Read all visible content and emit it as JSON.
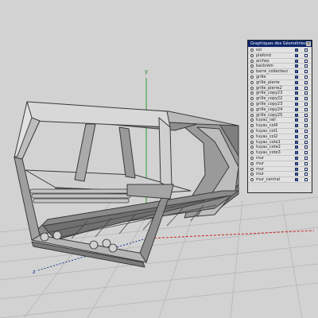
{
  "panel": {
    "title": "Graphiques des Géométries",
    "layers": [
      "sol",
      "plafond",
      "arches",
      "backrèm",
      "barre_collecteur",
      "grille",
      "grille_pierre",
      "grille_pierre2",
      "grille_copy23",
      "grille_copy22",
      "grille_copy23",
      "grille_copy24",
      "grille_copy25",
      "tuyau_rail",
      "tuyau_col4",
      "tuyau_col1",
      "tuyau_col2",
      "tuyau_cote1",
      "tuyau_cote2",
      "tuyau_cote3",
      "mur",
      "mur",
      "mur",
      "mur",
      "mur_central"
    ]
  },
  "viewport": {
    "axis_y_label": "y",
    "axis_z_label": "z"
  },
  "colors": {
    "background": "#d2d2d2",
    "grid": "#b8b8b8",
    "axis_x": "#cc2222",
    "axis_y": "#2e9d32",
    "axis_z": "#1a3a8a",
    "title_bar": "#0a246a",
    "model_light": "#a9a9a9",
    "model_dark": "#5a5a5a"
  }
}
